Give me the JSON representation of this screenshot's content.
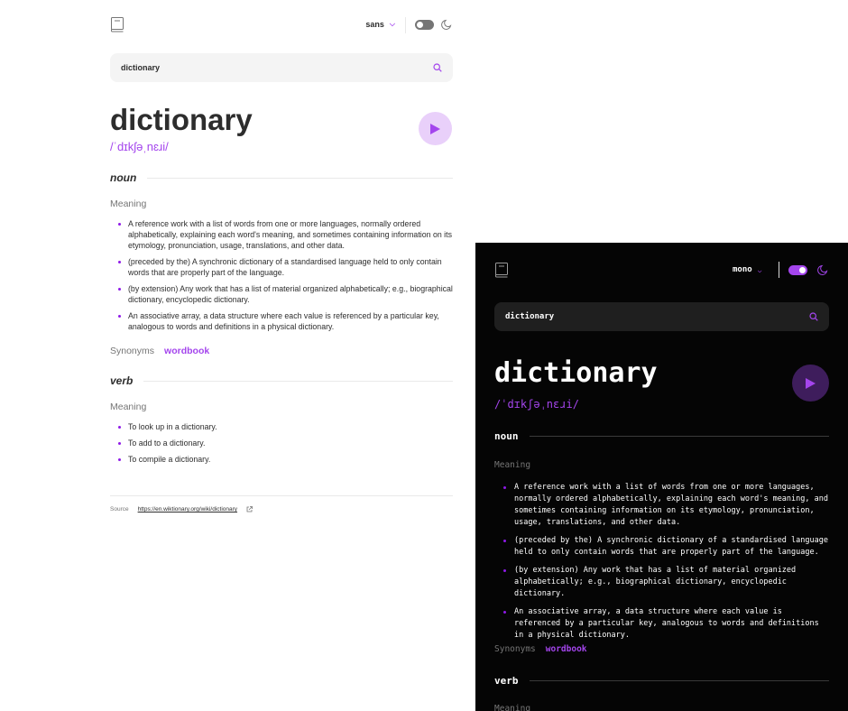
{
  "light": {
    "font_select": "sans",
    "search_value": "dictionary",
    "word": "dictionary",
    "phonetic": "/ˈdɪkʃəˌnɛɹi/",
    "noun_label": "noun",
    "meaning_label": "Meaning",
    "noun_defs": [
      "A reference work with a list of words from one or more languages, normally ordered alphabetically, explaining each word's meaning, and sometimes containing information on its etymology, pronunciation, usage, translations, and other data.",
      "(preceded by the) A synchronic dictionary of a standardised language held to only contain words that are properly part of the language.",
      "(by extension) Any work that has a list of material organized alphabetically; e.g., biographical dictionary, encyclopedic dictionary.",
      "An associative array, a data structure where each value is referenced by a particular key, analogous to words and definitions in a physical dictionary."
    ],
    "synonyms_label": "Synonyms",
    "synonym": "wordbook",
    "verb_label": "verb",
    "verb_defs": [
      "To look up in a dictionary.",
      "To add to a dictionary.",
      "To compile a dictionary."
    ],
    "source_label": "Source",
    "source_url": "https://en.wiktionary.org/wiki/dictionary"
  },
  "dark": {
    "font_select": "mono",
    "search_value": "dictionary",
    "word": "dictionary",
    "phonetic": "/ˈdɪkʃəˌnɛɹi/",
    "noun_label": "noun",
    "meaning_label": "Meaning",
    "noun_defs": [
      "A reference work with a list of words from one or more languages, normally ordered alphabetically, explaining each word's meaning, and sometimes containing information on its etymology, pronunciation, usage, translations, and other data.",
      "(preceded by the) A synchronic dictionary of a standardised language held to only contain words that are properly part of the language.",
      "(by extension) Any work that has a list of material organized alphabetically; e.g., biographical dictionary, encyclopedic dictionary.",
      "An associative array, a data structure where each value is referenced by a particular key, analogous to words and definitions in a physical dictionary."
    ],
    "synonyms_label": "Synonyms",
    "synonym": "wordbook",
    "verb_label": "verb",
    "meaning_label_2": "Meaning"
  },
  "colors": {
    "accent": "#a445ed",
    "accent_light_bg": "#e9d0fa",
    "dark_bg": "#050505",
    "dark_search_bg": "#1f1f1f",
    "light_search_bg": "#f4f4f4"
  },
  "icons": {
    "logo": "book-icon",
    "theme": "moon-icon",
    "search": "search-icon",
    "play": "play-icon",
    "external": "external-link-icon",
    "dropdown": "chevron-down-icon"
  }
}
